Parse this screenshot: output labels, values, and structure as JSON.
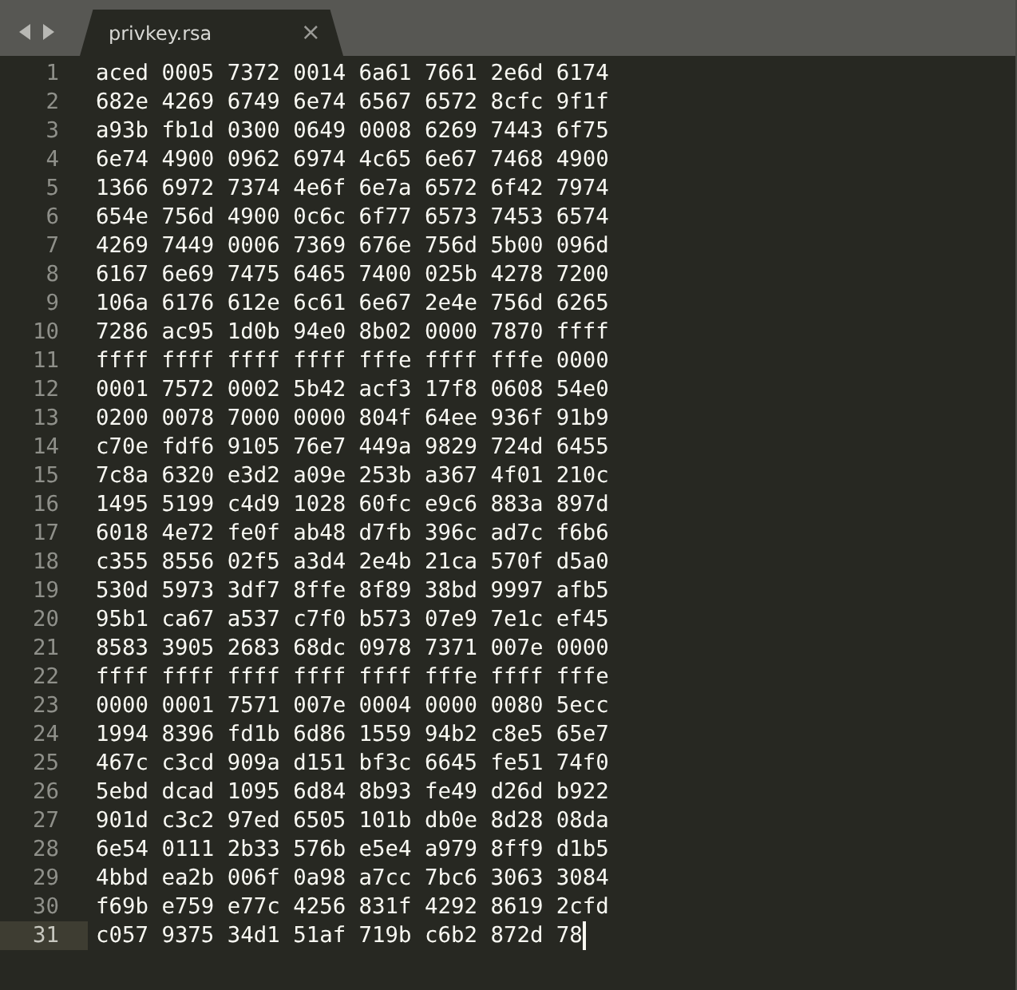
{
  "tab": {
    "title": "privkey.rsa",
    "close": "×"
  },
  "lines": [
    {
      "number": "1",
      "text": "aced 0005 7372 0014 6a61 7661 2e6d 6174",
      "current": false
    },
    {
      "number": "2",
      "text": "682e 4269 6749 6e74 6567 6572 8cfc 9f1f",
      "current": false
    },
    {
      "number": "3",
      "text": "a93b fb1d 0300 0649 0008 6269 7443 6f75",
      "current": false
    },
    {
      "number": "4",
      "text": "6e74 4900 0962 6974 4c65 6e67 7468 4900",
      "current": false
    },
    {
      "number": "5",
      "text": "1366 6972 7374 4e6f 6e7a 6572 6f42 7974",
      "current": false
    },
    {
      "number": "6",
      "text": "654e 756d 4900 0c6c 6f77 6573 7453 6574",
      "current": false
    },
    {
      "number": "7",
      "text": "4269 7449 0006 7369 676e 756d 5b00 096d",
      "current": false
    },
    {
      "number": "8",
      "text": "6167 6e69 7475 6465 7400 025b 4278 7200",
      "current": false
    },
    {
      "number": "9",
      "text": "106a 6176 612e 6c61 6e67 2e4e 756d 6265",
      "current": false
    },
    {
      "number": "10",
      "text": "7286 ac95 1d0b 94e0 8b02 0000 7870 ffff",
      "current": false
    },
    {
      "number": "11",
      "text": "ffff ffff ffff ffff fffe ffff fffe 0000",
      "current": false
    },
    {
      "number": "12",
      "text": "0001 7572 0002 5b42 acf3 17f8 0608 54e0",
      "current": false
    },
    {
      "number": "13",
      "text": "0200 0078 7000 0000 804f 64ee 936f 91b9",
      "current": false
    },
    {
      "number": "14",
      "text": "c70e fdf6 9105 76e7 449a 9829 724d 6455",
      "current": false
    },
    {
      "number": "15",
      "text": "7c8a 6320 e3d2 a09e 253b a367 4f01 210c",
      "current": false
    },
    {
      "number": "16",
      "text": "1495 5199 c4d9 1028 60fc e9c6 883a 897d",
      "current": false
    },
    {
      "number": "17",
      "text": "6018 4e72 fe0f ab48 d7fb 396c ad7c f6b6",
      "current": false
    },
    {
      "number": "18",
      "text": "c355 8556 02f5 a3d4 2e4b 21ca 570f d5a0",
      "current": false
    },
    {
      "number": "19",
      "text": "530d 5973 3df7 8ffe 8f89 38bd 9997 afb5",
      "current": false
    },
    {
      "number": "20",
      "text": "95b1 ca67 a537 c7f0 b573 07e9 7e1c ef45",
      "current": false
    },
    {
      "number": "21",
      "text": "8583 3905 2683 68dc 0978 7371 007e 0000",
      "current": false
    },
    {
      "number": "22",
      "text": "ffff ffff ffff ffff ffff fffe ffff fffe",
      "current": false
    },
    {
      "number": "23",
      "text": "0000 0001 7571 007e 0004 0000 0080 5ecc",
      "current": false
    },
    {
      "number": "24",
      "text": "1994 8396 fd1b 6d86 1559 94b2 c8e5 65e7",
      "current": false
    },
    {
      "number": "25",
      "text": "467c c3cd 909a d151 bf3c 6645 fe51 74f0",
      "current": false
    },
    {
      "number": "26",
      "text": "5ebd dcad 1095 6d84 8b93 fe49 d26d b922",
      "current": false
    },
    {
      "number": "27",
      "text": "901d c3c2 97ed 6505 101b db0e 8d28 08da",
      "current": false
    },
    {
      "number": "28",
      "text": "6e54 0111 2b33 576b e5e4 a979 8ff9 d1b5",
      "current": false
    },
    {
      "number": "29",
      "text": "4bbd ea2b 006f 0a98 a7cc 7bc6 3063 3084",
      "current": false
    },
    {
      "number": "30",
      "text": "f69b e759 e77c 4256 831f 4292 8619 2cfd",
      "current": false
    },
    {
      "number": "31",
      "text": "c057 9375 34d1 51af 719b c6b2 872d 78",
      "current": true
    }
  ]
}
